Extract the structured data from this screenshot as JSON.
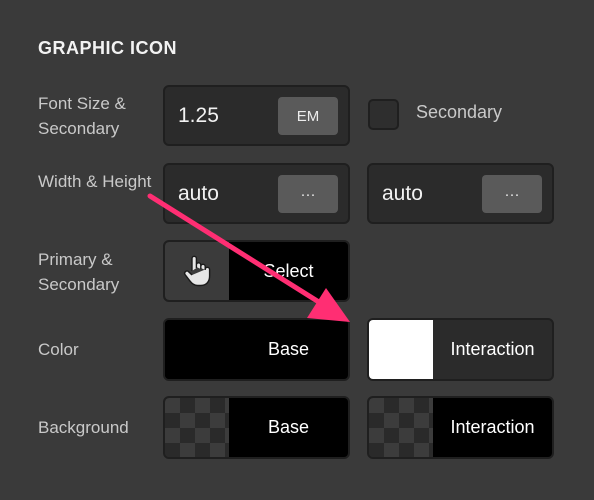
{
  "section": {
    "title": "GRAPHIC ICON"
  },
  "rows": {
    "font_size": {
      "label": "Font Size & Secondary",
      "value": "1.25",
      "unit": "EM",
      "secondary_label": "Secondary",
      "secondary_checked": false
    },
    "width_height": {
      "label": "Width & Height",
      "width_value": "auto",
      "height_value": "auto",
      "more_label": "···"
    },
    "primary_secondary": {
      "label": "Primary & Secondary",
      "icon": "hand-pointer-icon",
      "button_label": "Select"
    },
    "color": {
      "label": "Color",
      "base_label": "Base",
      "base_color": "#000000",
      "interaction_label": "Interaction",
      "interaction_color": "#ffffff"
    },
    "background": {
      "label": "Background",
      "base_label": "Base",
      "interaction_label": "Interaction"
    }
  },
  "annotation": {
    "arrow_color": "#ff2e73"
  }
}
